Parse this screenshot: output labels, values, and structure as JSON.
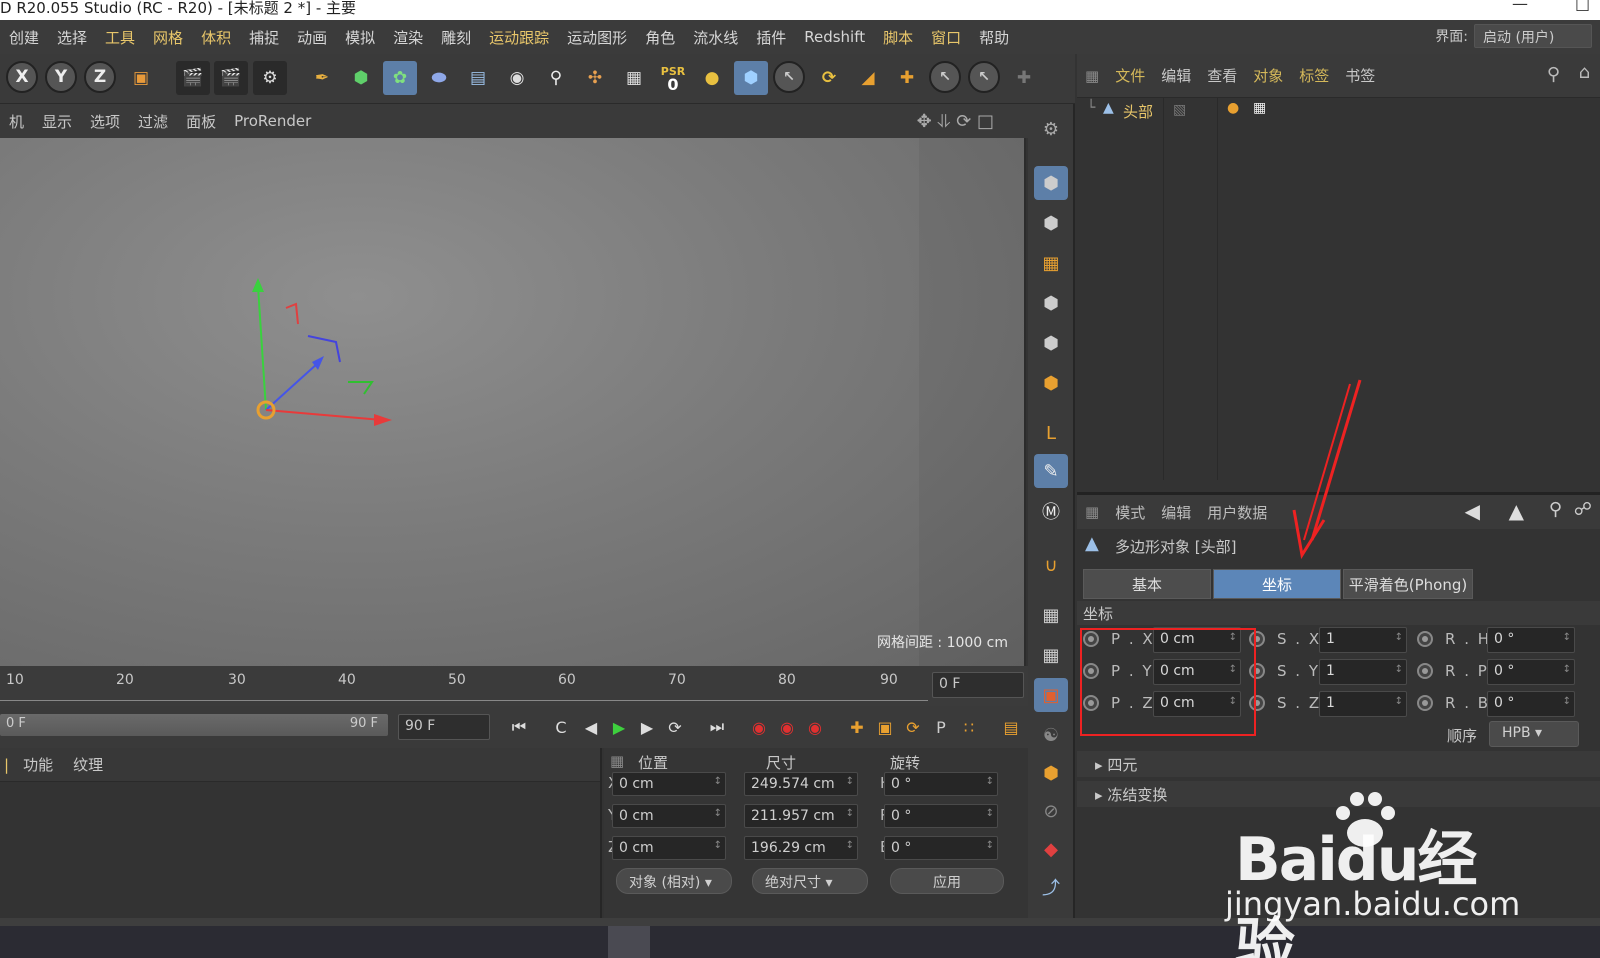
{
  "window": {
    "title": "D R20.055 Studio (RC - R20) - [未标题 2 *] - 主要"
  },
  "menubar": {
    "items": [
      {
        "label": "创建",
        "accent": false
      },
      {
        "label": "选择",
        "accent": false
      },
      {
        "label": "工具",
        "accent": true
      },
      {
        "label": "网格",
        "accent": true
      },
      {
        "label": "体积",
        "accent": true
      },
      {
        "label": "捕捉",
        "accent": false
      },
      {
        "label": "动画",
        "accent": false
      },
      {
        "label": "模拟",
        "accent": false
      },
      {
        "label": "渲染",
        "accent": false
      },
      {
        "label": "雕刻",
        "accent": false
      },
      {
        "label": "运动跟踪",
        "accent": true
      },
      {
        "label": "运动图形",
        "accent": false
      },
      {
        "label": "角色",
        "accent": false
      },
      {
        "label": "流水线",
        "accent": false
      },
      {
        "label": "插件",
        "accent": false
      },
      {
        "label": "Redshift",
        "accent": false
      },
      {
        "label": "脚本",
        "accent": true
      },
      {
        "label": "窗口",
        "accent": true
      },
      {
        "label": "帮助",
        "accent": false
      }
    ],
    "layout_label": "界面:",
    "layout_value": "启动 (用户)"
  },
  "toolbar": {
    "axis_x": "X",
    "axis_y": "Y",
    "axis_z": "Z",
    "psr_label": "PSR",
    "psr_value": "0"
  },
  "viewport_menu": {
    "items": [
      "机",
      "显示",
      "选项",
      "过滤",
      "面板",
      "ProRender"
    ]
  },
  "viewport": {
    "grid_spacing": "网格间距 : 1000 cm"
  },
  "timeline": {
    "ticks": [
      "10",
      "20",
      "30",
      "40",
      "50",
      "60",
      "70",
      "80",
      "90"
    ],
    "current_frame": "0 F",
    "slider_start": "0 F",
    "slider_end": "90 F",
    "end_frame": "90 F"
  },
  "material_panel": {
    "menu": [
      "功能",
      "纹理"
    ]
  },
  "coord_panel": {
    "headers": {
      "position": "位置",
      "size": "尺寸",
      "rotation": "旋转"
    },
    "rows": [
      {
        "axis": "X",
        "pos": "0 cm",
        "size_axis": "X",
        "size": "249.574 cm",
        "rot_axis": "H",
        "rot": "0 °"
      },
      {
        "axis": "Y",
        "pos": "0 cm",
        "size_axis": "Y",
        "size": "211.957 cm",
        "rot_axis": "P",
        "rot": "0 °"
      },
      {
        "axis": "Z",
        "pos": "0 cm",
        "size_axis": "Z",
        "size": "196.29 cm",
        "rot_axis": "B",
        "rot": "0 °"
      }
    ],
    "mode": "对象 (相对)",
    "size_mode": "绝对尺寸",
    "apply": "应用"
  },
  "object_manager": {
    "menu": [
      {
        "label": "文件",
        "accent": true
      },
      {
        "label": "编辑",
        "accent": false
      },
      {
        "label": "查看",
        "accent": false
      },
      {
        "label": "对象",
        "accent": true
      },
      {
        "label": "标签",
        "accent": true
      },
      {
        "label": "书签",
        "accent": false
      }
    ],
    "object_name": "头部"
  },
  "attributes": {
    "menu": [
      "模式",
      "编辑",
      "用户数据"
    ],
    "object_title": "多边形对象 [头部]",
    "tabs": [
      {
        "label": "基本",
        "active": false
      },
      {
        "label": "坐标",
        "active": true
      },
      {
        "label": "平滑着色(Phong)",
        "active": false
      }
    ],
    "section": "坐标",
    "pos": [
      {
        "label": "P . X",
        "value": "0 cm"
      },
      {
        "label": "P . Y",
        "value": "0 cm"
      },
      {
        "label": "P . Z",
        "value": "0 cm"
      }
    ],
    "scale": [
      {
        "label": "S . X",
        "value": "1"
      },
      {
        "label": "S . Y",
        "value": "1"
      },
      {
        "label": "S . Z",
        "value": "1"
      }
    ],
    "rot": [
      {
        "label": "R . H",
        "value": "0 °"
      },
      {
        "label": "R . P",
        "value": "0 °"
      },
      {
        "label": "R . B",
        "value": "0 °"
      }
    ],
    "order_label": "顺序",
    "order_value": "HPB",
    "quaternion": "四元",
    "freeze": "冻结变换"
  },
  "watermark": {
    "brand": "Baidu经验",
    "url": "jingyan.baidu.com"
  },
  "colors": {
    "accent_menu": "#e8c66a",
    "active_tab": "#5c86b8",
    "highlight_box": "#e22222"
  }
}
